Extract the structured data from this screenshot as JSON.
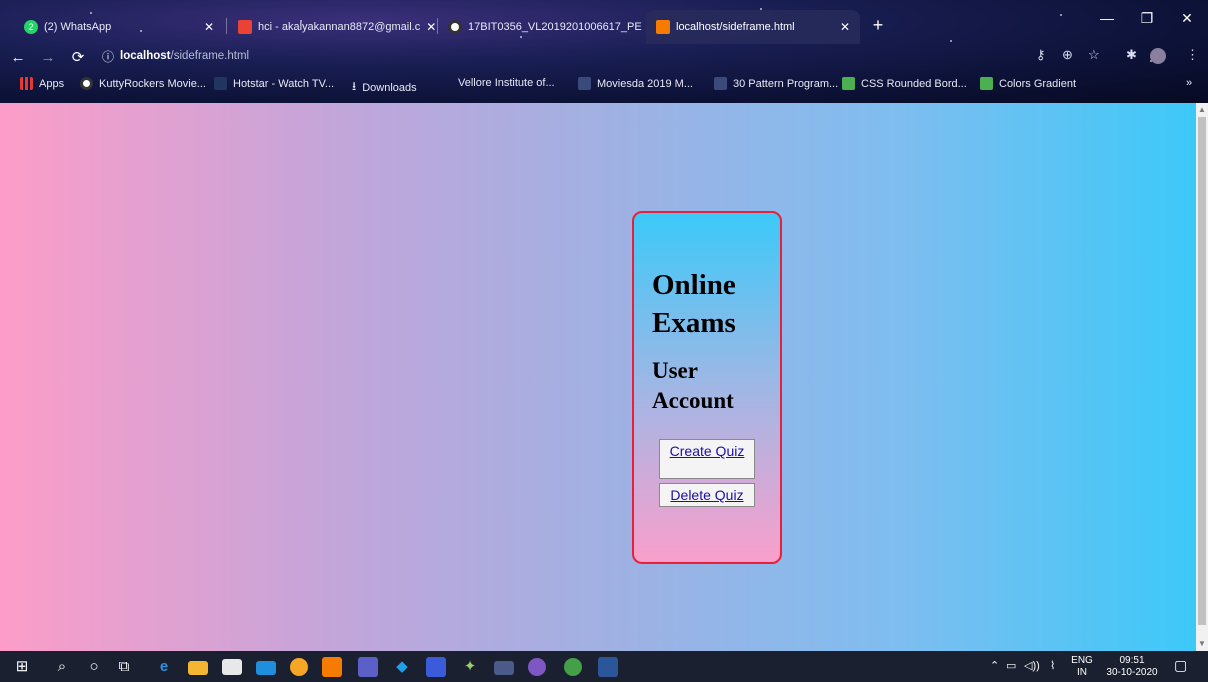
{
  "browser": {
    "tabs": [
      {
        "label": "(2) WhatsApp",
        "badge": "2"
      },
      {
        "label": "hci - akalyakannan8872@gmail.c"
      },
      {
        "label": "17BIT0356_VL2019201006617_PE"
      },
      {
        "label": "localhost/sideframe.html",
        "active": true
      }
    ],
    "address": {
      "host": "localhost",
      "path": "/sideframe.html"
    },
    "bookmarks": [
      {
        "label": "Apps"
      },
      {
        "label": "KuttyRockers Movie..."
      },
      {
        "label": "Hotstar - Watch TV..."
      },
      {
        "label": "Downloads"
      },
      {
        "label": "Vellore Institute of..."
      },
      {
        "label": "Moviesda 2019 M..."
      },
      {
        "label": "30 Pattern Program..."
      },
      {
        "label": "CSS Rounded Bord..."
      },
      {
        "label": "Colors Gradient"
      }
    ],
    "more_bookmarks": "»"
  },
  "page": {
    "title": "Online Exams",
    "subtitle": "User Account",
    "create_label": "Create Quiz",
    "delete_label": "Delete Quiz"
  },
  "taskbar": {
    "language": "ENG",
    "region": "IN",
    "time": "09:51",
    "date": "30-10-2020"
  },
  "colors": {
    "card_border": "#e8203b",
    "gradient_left": "#fc9dc8",
    "gradient_right": "#3cc9f8"
  }
}
